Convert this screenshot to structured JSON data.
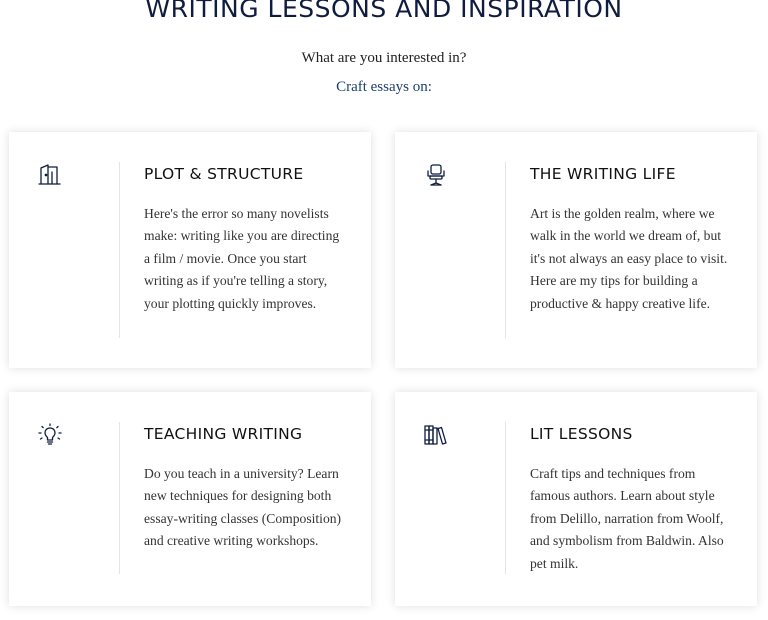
{
  "header": {
    "title": "WRITING LESSONS AND INSPIRATION",
    "subtitle": "What are you interested in?",
    "link_text": "Craft essays on:"
  },
  "cards": [
    {
      "icon": "door-icon",
      "title": "PLOT & STRUCTURE",
      "body": "Here's the error so many novelists make: writing like you are directing a film / movie. Once you start writing as if you're telling a story, your plotting quickly improves."
    },
    {
      "icon": "desk-chair-icon",
      "title": "THE WRITING LIFE",
      "body": "Art is the golden realm, where we walk in the world we dream of, but it's not always an easy place to visit. Here are my  tips for building a productive & happy creative life."
    },
    {
      "icon": "lightbulb-icon",
      "title": "TEACHING WRITING",
      "body": "Do you teach in a university? Learn new techniques for designing both essay-writing classes (Composition) and creative writing workshops."
    },
    {
      "icon": "books-icon",
      "title": "LIT LESSONS",
      "body": "Craft tips and techniques from famous authors. Learn about style from Delillo, narration from Woolf, and symbolism from Baldwin. Also pet milk."
    }
  ],
  "colors": {
    "title": "#0f1c3f",
    "link": "#1d3f6e",
    "icon": "#0f1c3f"
  }
}
